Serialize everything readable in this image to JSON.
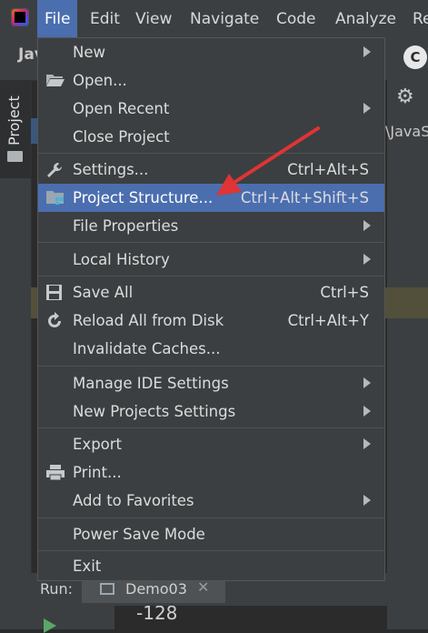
{
  "menubar": {
    "items": [
      {
        "label": "File",
        "active": true
      },
      {
        "label": "Edit"
      },
      {
        "label": "View"
      },
      {
        "label": "Navigate"
      },
      {
        "label": "Code"
      },
      {
        "label": "Analyze"
      },
      {
        "label": "Re"
      }
    ]
  },
  "background": {
    "toolbar_text": "Jav",
    "project_tab": "Project",
    "path_fragment": "\\JavaS",
    "run_label": "Run:",
    "run_tab": "Demo03",
    "run_close": "✕",
    "output_value": "-128",
    "badge": "C"
  },
  "file_menu": {
    "items": [
      {
        "label": "New",
        "submenu": true
      },
      {
        "label": "Open...",
        "icon": "folder-open-icon"
      },
      {
        "label": "Open Recent",
        "submenu": true
      },
      {
        "label": "Close Project"
      },
      {
        "label": "Settings...",
        "shortcut": "Ctrl+Alt+S",
        "icon": "wrench-icon"
      },
      {
        "label": "Project Structure...",
        "shortcut": "Ctrl+Alt+Shift+S",
        "icon": "project-structure-icon",
        "selected": true
      },
      {
        "label": "File Properties",
        "submenu": true
      },
      {
        "label": "Local History",
        "submenu": true
      },
      {
        "label": "Save All",
        "shortcut": "Ctrl+S",
        "icon": "save-icon"
      },
      {
        "label": "Reload All from Disk",
        "shortcut": "Ctrl+Alt+Y",
        "icon": "reload-icon"
      },
      {
        "label": "Invalidate Caches..."
      },
      {
        "label": "Manage IDE Settings",
        "submenu": true
      },
      {
        "label": "New Projects Settings",
        "submenu": true
      },
      {
        "label": "Export",
        "submenu": true
      },
      {
        "label": "Print...",
        "icon": "printer-icon"
      },
      {
        "label": "Add to Favorites",
        "submenu": true
      },
      {
        "label": "Power Save Mode"
      },
      {
        "label": "Exit"
      }
    ]
  },
  "annotation": {
    "color": "#e03434",
    "icon": "red-arrow-annotation"
  },
  "colors": {
    "selection": "#4b6eaf",
    "menu_bg": "#3c3f41",
    "editor_bg": "#2b2b2b"
  }
}
